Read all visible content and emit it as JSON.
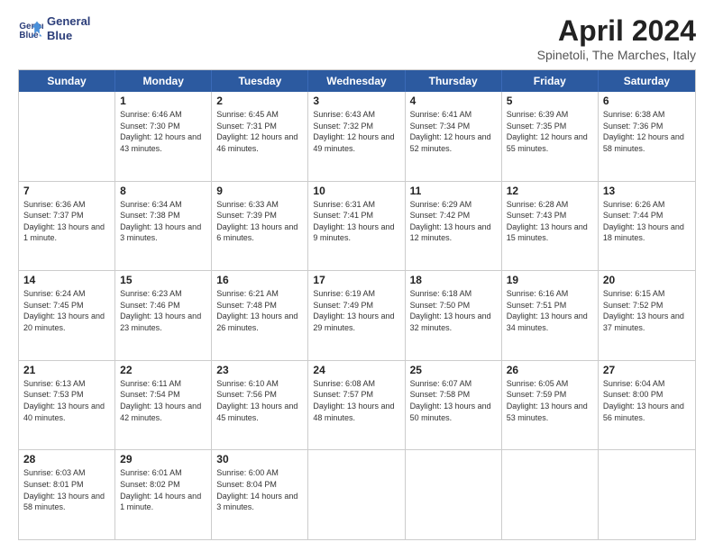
{
  "header": {
    "logo_line1": "General",
    "logo_line2": "Blue",
    "title": "April 2024",
    "subtitle": "Spinetoli, The Marches, Italy"
  },
  "days_of_week": [
    "Sunday",
    "Monday",
    "Tuesday",
    "Wednesday",
    "Thursday",
    "Friday",
    "Saturday"
  ],
  "weeks": [
    [
      {
        "day": "",
        "empty": true
      },
      {
        "day": "1",
        "sunrise": "6:46 AM",
        "sunset": "7:30 PM",
        "daylight": "12 hours and 43 minutes."
      },
      {
        "day": "2",
        "sunrise": "6:45 AM",
        "sunset": "7:31 PM",
        "daylight": "12 hours and 46 minutes."
      },
      {
        "day": "3",
        "sunrise": "6:43 AM",
        "sunset": "7:32 PM",
        "daylight": "12 hours and 49 minutes."
      },
      {
        "day": "4",
        "sunrise": "6:41 AM",
        "sunset": "7:34 PM",
        "daylight": "12 hours and 52 minutes."
      },
      {
        "day": "5",
        "sunrise": "6:39 AM",
        "sunset": "7:35 PM",
        "daylight": "12 hours and 55 minutes."
      },
      {
        "day": "6",
        "sunrise": "6:38 AM",
        "sunset": "7:36 PM",
        "daylight": "12 hours and 58 minutes."
      }
    ],
    [
      {
        "day": "7",
        "sunrise": "6:36 AM",
        "sunset": "7:37 PM",
        "daylight": "13 hours and 1 minute."
      },
      {
        "day": "8",
        "sunrise": "6:34 AM",
        "sunset": "7:38 PM",
        "daylight": "13 hours and 3 minutes."
      },
      {
        "day": "9",
        "sunrise": "6:33 AM",
        "sunset": "7:39 PM",
        "daylight": "13 hours and 6 minutes."
      },
      {
        "day": "10",
        "sunrise": "6:31 AM",
        "sunset": "7:41 PM",
        "daylight": "13 hours and 9 minutes."
      },
      {
        "day": "11",
        "sunrise": "6:29 AM",
        "sunset": "7:42 PM",
        "daylight": "13 hours and 12 minutes."
      },
      {
        "day": "12",
        "sunrise": "6:28 AM",
        "sunset": "7:43 PM",
        "daylight": "13 hours and 15 minutes."
      },
      {
        "day": "13",
        "sunrise": "6:26 AM",
        "sunset": "7:44 PM",
        "daylight": "13 hours and 18 minutes."
      }
    ],
    [
      {
        "day": "14",
        "sunrise": "6:24 AM",
        "sunset": "7:45 PM",
        "daylight": "13 hours and 20 minutes."
      },
      {
        "day": "15",
        "sunrise": "6:23 AM",
        "sunset": "7:46 PM",
        "daylight": "13 hours and 23 minutes."
      },
      {
        "day": "16",
        "sunrise": "6:21 AM",
        "sunset": "7:48 PM",
        "daylight": "13 hours and 26 minutes."
      },
      {
        "day": "17",
        "sunrise": "6:19 AM",
        "sunset": "7:49 PM",
        "daylight": "13 hours and 29 minutes."
      },
      {
        "day": "18",
        "sunrise": "6:18 AM",
        "sunset": "7:50 PM",
        "daylight": "13 hours and 32 minutes."
      },
      {
        "day": "19",
        "sunrise": "6:16 AM",
        "sunset": "7:51 PM",
        "daylight": "13 hours and 34 minutes."
      },
      {
        "day": "20",
        "sunrise": "6:15 AM",
        "sunset": "7:52 PM",
        "daylight": "13 hours and 37 minutes."
      }
    ],
    [
      {
        "day": "21",
        "sunrise": "6:13 AM",
        "sunset": "7:53 PM",
        "daylight": "13 hours and 40 minutes."
      },
      {
        "day": "22",
        "sunrise": "6:11 AM",
        "sunset": "7:54 PM",
        "daylight": "13 hours and 42 minutes."
      },
      {
        "day": "23",
        "sunrise": "6:10 AM",
        "sunset": "7:56 PM",
        "daylight": "13 hours and 45 minutes."
      },
      {
        "day": "24",
        "sunrise": "6:08 AM",
        "sunset": "7:57 PM",
        "daylight": "13 hours and 48 minutes."
      },
      {
        "day": "25",
        "sunrise": "6:07 AM",
        "sunset": "7:58 PM",
        "daylight": "13 hours and 50 minutes."
      },
      {
        "day": "26",
        "sunrise": "6:05 AM",
        "sunset": "7:59 PM",
        "daylight": "13 hours and 53 minutes."
      },
      {
        "day": "27",
        "sunrise": "6:04 AM",
        "sunset": "8:00 PM",
        "daylight": "13 hours and 56 minutes."
      }
    ],
    [
      {
        "day": "28",
        "sunrise": "6:03 AM",
        "sunset": "8:01 PM",
        "daylight": "13 hours and 58 minutes."
      },
      {
        "day": "29",
        "sunrise": "6:01 AM",
        "sunset": "8:02 PM",
        "daylight": "14 hours and 1 minute."
      },
      {
        "day": "30",
        "sunrise": "6:00 AM",
        "sunset": "8:04 PM",
        "daylight": "14 hours and 3 minutes."
      },
      {
        "day": "",
        "empty": true
      },
      {
        "day": "",
        "empty": true
      },
      {
        "day": "",
        "empty": true
      },
      {
        "day": "",
        "empty": true
      }
    ]
  ]
}
